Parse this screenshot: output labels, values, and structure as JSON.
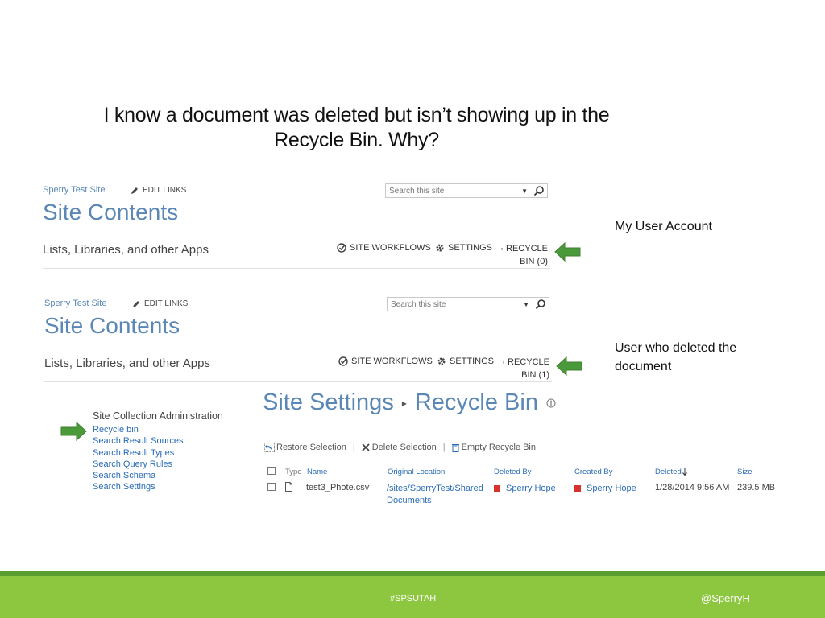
{
  "slide": {
    "title_line1": "I know a document was deleted but isn’t showing up in the",
    "title_line2": "Recycle Bin.  Why?"
  },
  "panel1": {
    "site_name": "Sperry Test Site",
    "edit_links": "EDIT LINKS",
    "search_placeholder": "Search this site",
    "heading": "Site Contents",
    "subheading": "Lists, Libraries, and other Apps",
    "site_workflows": "SITE WORKFLOWS",
    "settings": "SETTINGS",
    "recycle_line1": "RECYCLE",
    "recycle_line2": "BIN (0)",
    "note": "My User Account"
  },
  "panel2": {
    "site_name": "Sperry Test Site",
    "edit_links": "EDIT LINKS",
    "search_placeholder": "Search this site",
    "heading": "Site Contents",
    "subheading": "Lists, Libraries, and other Apps",
    "site_workflows": "SITE WORKFLOWS",
    "settings": "SETTINGS",
    "recycle_line1": "RECYCLE",
    "recycle_line2": "BIN (1)",
    "note_line1": "User who deleted the",
    "note_line2": "document"
  },
  "site_collection_admin": {
    "title": "Site Collection Administration",
    "links": [
      "Recycle bin",
      "Search Result Sources",
      "Search Result Types",
      "Search Query Rules",
      "Search Schema",
      "Search Settings"
    ]
  },
  "recycle_page": {
    "title_part1": "Site Settings",
    "title_part2": "Recycle Bin",
    "actions": {
      "restore": "Restore Selection",
      "delete": "Delete Selection",
      "empty": "Empty Recycle Bin",
      "separator": "|"
    },
    "columns": [
      "Type",
      "Name",
      "Original Location",
      "Deleted By",
      "Created By",
      "Deleted",
      "Size"
    ],
    "rows": [
      {
        "name": "test3_Phote.csv",
        "location_line1": "/sites/SperryTest/Shared",
        "location_line2": "Documents",
        "deleted_by": "Sperry Hope",
        "created_by": "Sperry Hope",
        "deleted": "1/28/2014 9:56 AM",
        "size": "239.5 MB"
      }
    ]
  },
  "footer": {
    "hashtag": "#SPSUTAH",
    "handle": "@SperryH"
  },
  "colors": {
    "sharepoint_blue": "#5a87b5",
    "link_blue": "#2a6cb7",
    "arrow_green": "#4a9a3a",
    "footer_green": "#8dc63f",
    "footer_line": "#5a9e32"
  }
}
